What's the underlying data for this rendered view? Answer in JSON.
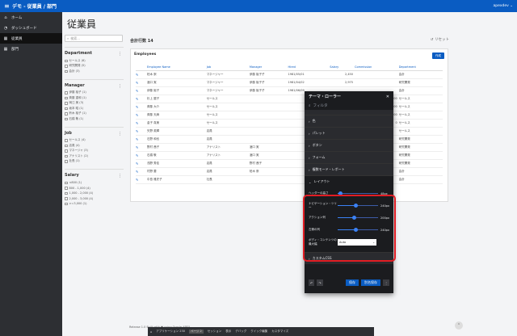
{
  "app": {
    "menu_icon": "hamburger-icon",
    "title": "デモ - 従業員 / 部門",
    "user": "apexdev ⌄"
  },
  "sidebar": {
    "items": [
      {
        "label": "ホーム",
        "icon": "home-icon",
        "active": false
      },
      {
        "label": "ダッシュボード",
        "icon": "dashboard-icon",
        "active": false
      },
      {
        "label": "従業員",
        "icon": "table-icon",
        "active": true
      },
      {
        "label": "部門",
        "icon": "table-icon",
        "active": false
      }
    ]
  },
  "page": {
    "title": "従業員"
  },
  "search": {
    "placeholder": "検索..."
  },
  "facets": [
    {
      "title": "Department",
      "options": [
        "セールス (6)",
        "研究開発 (5)",
        "会計 (3)"
      ]
    },
    {
      "title": "Manager",
      "options": [
        "伊藤 裕子 (1)",
        "斉藤 重和 (1)",
        "岡江 美 (3)",
        "坂本 昭 (1)",
        "鈴木 裕子 (1)",
        "石橋 敬 (1)"
      ]
    },
    {
      "title": "Job",
      "options": [
        "セールス (4)",
        "店員 (4)",
        "マネージャ (3)",
        "アナリスト (2)",
        "社長 (1)"
      ]
    },
    {
      "title": "Salary",
      "options": [
        "<800 (1)",
        "800 - 1,000 (4)",
        "1,000 - 2,000 (4)",
        "2,000 - 3,000 (4)",
        ">=3,000 (1)"
      ]
    }
  ],
  "main": {
    "total": "合計行数 14",
    "reset": "リセット"
  },
  "report": {
    "title": "Employees",
    "create": "作成",
    "columns": [
      "Employee Name",
      "Job",
      "Manager",
      "Hired",
      "Salary",
      "Commission",
      "Department"
    ],
    "rows": [
      [
        "柏木 崇",
        "マネージャー",
        "伊藤 裕子子",
        "1981/05/01",
        "2,450",
        "",
        "会計"
      ],
      [
        "酒口 実",
        "マネージャー",
        "伊藤 裕子子",
        "1981/04/02",
        "2,975",
        "",
        "研究開発"
      ],
      [
        "伊藤 裕子",
        "マネージャー",
        "伊藤 裕子子",
        "1981/06/09",
        "",
        "",
        "会計"
      ],
      [
        "杉上 麗子",
        "セールス",
        "",
        "",
        "",
        "300",
        "セールス"
      ],
      [
        "斉藤 大介",
        "セールス",
        "",
        "",
        "",
        "500",
        "セールス"
      ],
      [
        "斉藤 天麻",
        "セールス",
        "",
        "",
        "",
        "1,400",
        "セールス"
      ],
      [
        "金子 真美",
        "セールス",
        "",
        "",
        "",
        "0",
        "セールス"
      ],
      [
        "矢野 英輝",
        "店員",
        "",
        "",
        "",
        "",
        "セールス"
      ],
      [
        "石野 和也",
        "店員",
        "",
        "",
        "",
        "",
        "研究開発"
      ],
      [
        "野村 茜子",
        "アナリスト",
        "酒口 実",
        "",
        "",
        "",
        "研究開発"
      ],
      [
        "石橋 敬",
        "アナリスト",
        "酒口 実",
        "",
        "",
        "",
        "研究開発"
      ],
      [
        "浅野 秀佳",
        "店員",
        "野村 茜子",
        "",
        "",
        "",
        "研究開発"
      ],
      [
        "村野 要",
        "店員",
        "柏木 崇",
        "",
        "",
        "",
        "会計"
      ],
      [
        "中島 雅史子",
        "社長",
        "",
        "",
        "",
        "",
        "会計"
      ]
    ]
  },
  "roller": {
    "title": "テーマ・ローラー",
    "search_placeholder": "フィルタ",
    "sections": [
      "色",
      "パレット",
      "ボタン",
      "フォーム",
      "複数モード・レポート"
    ],
    "open_section": "レイアウト",
    "sliders": [
      {
        "label": "ヘッダーの高さ",
        "value": "48px",
        "fraction": 0.06
      },
      {
        "label": "ナビゲーション・ツリー",
        "value": "240px",
        "fraction": 0.45
      },
      {
        "label": "アクション列",
        "value": "200px",
        "fraction": 0.4
      },
      {
        "label": "左側の列",
        "value": "240px",
        "fraction": 0.45
      }
    ],
    "select": {
      "label": "ボディ・コンテンツの最大幅",
      "value": "Auto"
    },
    "custom_css": "カスタムCSS",
    "buttons": {
      "save": "保存",
      "save_as": "別名保存",
      "more": "⋮"
    }
  },
  "footer": {
    "text": "Release 1.0   Built with ❤ using Oracle APEX"
  },
  "devbar": {
    "items": [
      "⌂",
      "アプリケーション 230",
      "ページ 2",
      "セッション",
      "表示",
      "デバッグ",
      "クイック編集",
      "カスタマイズ"
    ],
    "active_index": 2
  }
}
